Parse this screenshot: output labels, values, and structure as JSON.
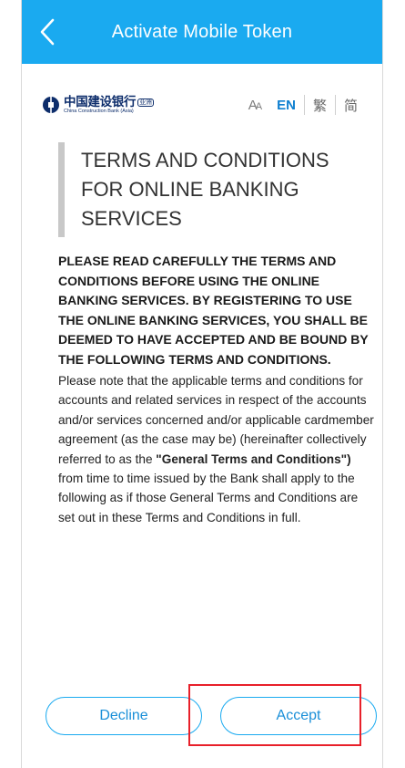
{
  "header": {
    "title": "Activate Mobile Token",
    "back_icon": "chevron-left-icon"
  },
  "brand": {
    "name_cn": "中国建设银行",
    "name_cn_suffix": "亚洲",
    "name_en": "China Construction Bank (Asia)",
    "logo_color": "#0d2d6b"
  },
  "language": {
    "font_size_label": "A",
    "font_size_label_small": "A",
    "options": [
      "EN",
      "繁",
      "简"
    ],
    "active": "EN"
  },
  "terms": {
    "heading": "TERMS AND CONDITIONS FOR ONLINE BANKING SERVICES",
    "intro": "PLEASE READ CAREFULLY THE TERMS AND CONDITIONS BEFORE USING THE ONLINE BANKING SERVICES. BY REGISTERING TO USE THE ONLINE BANKING SERVICES, YOU SHALL BE DEEMED TO HAVE ACCEPTED AND BE BOUND BY THE FOLLOWING TERMS AND CONDITIONS.",
    "note_part1": "Please note that the applicable terms and conditions for accounts and related services in respect of the accounts and/or services concerned and/or applicable cardmember agreement (as the case may be) (hereinafter collectively referred to as the ",
    "note_bold": "\"General Terms and Conditions\")",
    "note_part2": " from time to time issued by the Bank shall apply to the following as if those General Terms and Conditions are set out in these Terms and Conditions in full."
  },
  "actions": {
    "decline_label": "Decline",
    "accept_label": "Accept"
  },
  "colors": {
    "header_bg": "#1aaaf0",
    "accent": "#1a8fd8",
    "highlight": "#e8202a"
  }
}
